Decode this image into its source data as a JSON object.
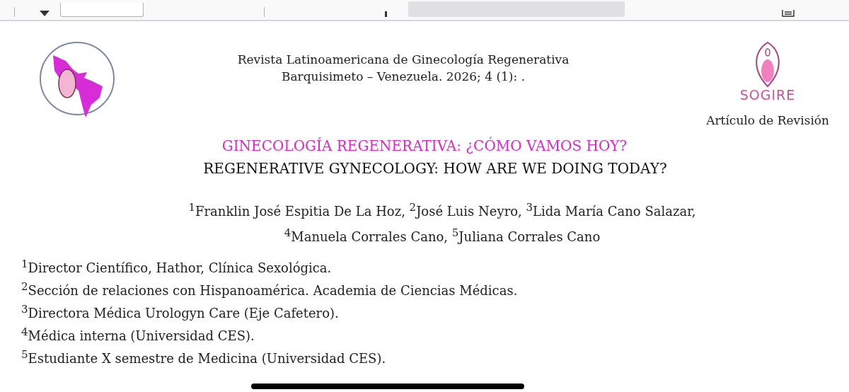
{
  "header": {
    "journal": [
      "Revista Latinoamericana de Ginecología Regenerativa",
      "Barquisimeto – Venezuela. 2026; 4 (1): ."
    ],
    "logo_text": "SOGIRE",
    "article_type": "Artículo de Revisión"
  },
  "title_es": "GINECOLOGÍA REGENERATIVA: ¿CÓMO VAMOS HOY?",
  "title_en": "REGENERATIVE GYNECOLOGY: HOW ARE WE DOING TODAY?",
  "authors": [
    "$^{1}$Franklin José Espitia De La Hoz, $^{2}$José Luis Neyro, $^{3}$Lida María Cano Salazar,",
    "$^{4}$Manuela Corrales Cano, $^{5}$Juliana Corrales Cano"
  ],
  "affiliations": [
    "$^{1}$Director Científico, Hathor, Clínica Sexológica.",
    "$^{2}$Sección de relaciones con Hispanoamérica. Academia de Ciencias Médicas.",
    "$^{3}$Directora Médica Urologyn Care (Eje Cafetero).",
    "$^{4}$Médica interna (Universidad CES).",
    "$^{5}$Estudiante X semestre de Medicina (Universidad CES)."
  ]
}
